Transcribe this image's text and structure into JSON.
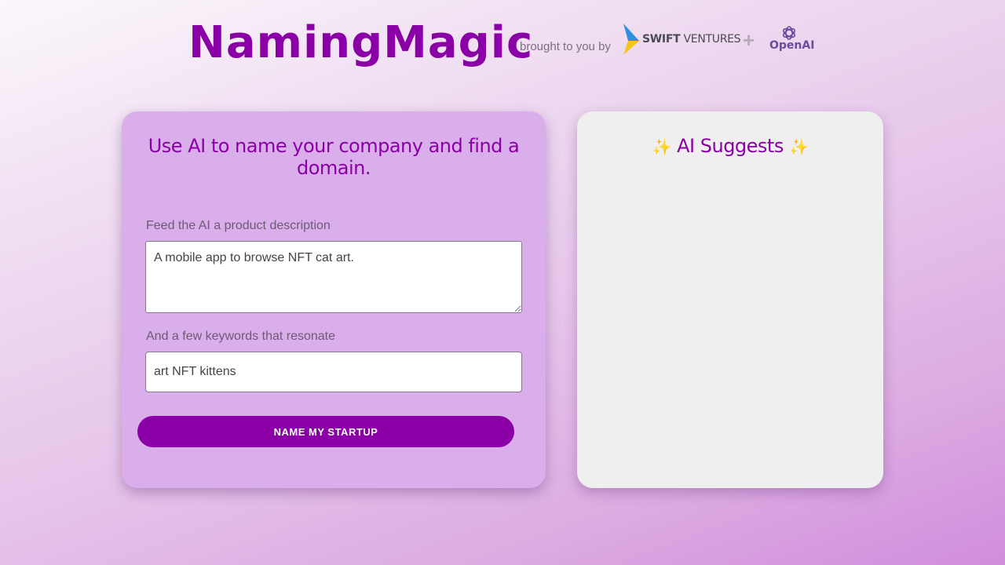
{
  "header": {
    "logo": "NamingMagic",
    "brought_by": "brought to you by",
    "partner1": {
      "name_bold": "SWIFT",
      "name_rest": "VENTURES"
    },
    "plus": "+",
    "partner2": {
      "name": "OpenAI"
    }
  },
  "form": {
    "title": "Use AI to name your company and find a domain.",
    "description_label": "Feed the AI a product description",
    "description_value": "A mobile app to browse NFT cat art.",
    "keywords_label": "And a few keywords that resonate",
    "keywords_value": "art NFT kittens",
    "submit_label": "NAME MY STARTUP"
  },
  "suggestions": {
    "title": "AI Suggests",
    "sparkle": "✨"
  },
  "colors": {
    "accent": "#8b00a6",
    "form_card": "#d9aeeb",
    "suggest_card": "#efefef"
  }
}
